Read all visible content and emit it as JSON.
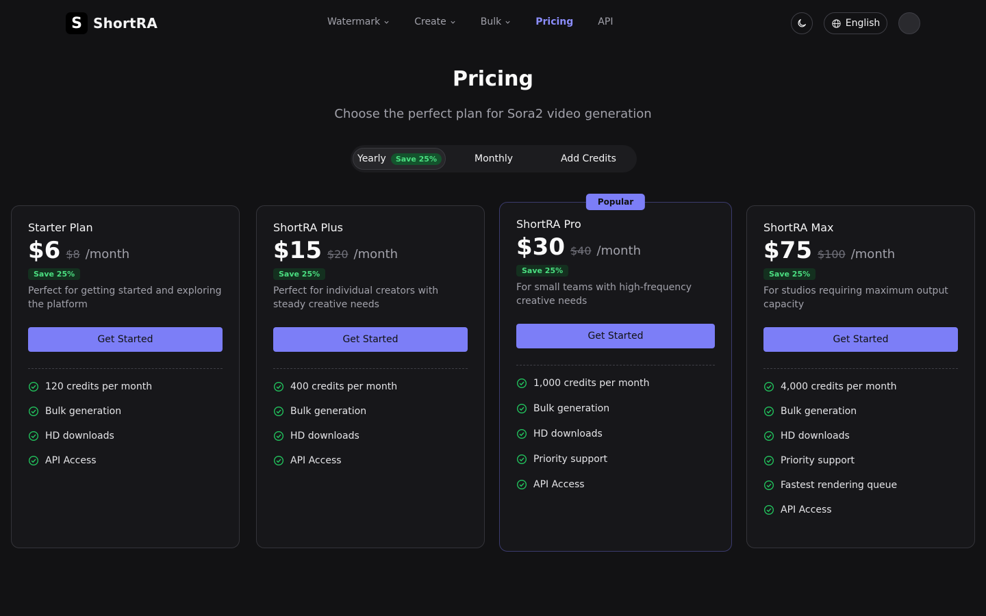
{
  "brand": {
    "logo_letter": "S",
    "name": "ShortRA"
  },
  "nav": {
    "items": [
      {
        "label": "Watermark",
        "dropdown": true
      },
      {
        "label": "Create",
        "dropdown": true
      },
      {
        "label": "Bulk",
        "dropdown": true
      },
      {
        "label": "Pricing",
        "active": true
      },
      {
        "label": "API"
      }
    ]
  },
  "header": {
    "theme_icon": "moon-icon",
    "language": "English"
  },
  "hero": {
    "title": "Pricing",
    "subtitle": "Choose the perfect plan for Sora2 video generation"
  },
  "billing_toggle": {
    "yearly": "Yearly",
    "yearly_badge": "Save 25%",
    "monthly": "Monthly",
    "credits": "Add Credits",
    "selected": "Yearly"
  },
  "colors": {
    "accent": "#7c7ef7",
    "save_green": "#4ade80",
    "background": "#121214"
  },
  "plans": [
    {
      "name": "Starter Plan",
      "price": "$6",
      "old_price": "$8",
      "period": "/month",
      "save": "Save 25%",
      "description": "Perfect for getting started and exploring the platform",
      "cta": "Get Started",
      "features": [
        "120 credits per month",
        "Bulk generation",
        "HD downloads",
        "API Access"
      ]
    },
    {
      "name": "ShortRA Plus",
      "price": "$15",
      "old_price": "$20",
      "period": "/month",
      "save": "Save 25%",
      "description": "Perfect for individual creators with steady creative needs",
      "cta": "Get Started",
      "features": [
        "400 credits per month",
        "Bulk generation",
        "HD downloads",
        "API Access"
      ]
    },
    {
      "name": "ShortRA Pro",
      "price": "$30",
      "old_price": "$40",
      "period": "/month",
      "save": "Save 25%",
      "badge": "Popular",
      "description": "For small teams with high-frequency creative needs",
      "cta": "Get Started",
      "features": [
        "1,000 credits per month",
        "Bulk generation",
        "HD downloads",
        "Priority support",
        "API Access"
      ]
    },
    {
      "name": "ShortRA Max",
      "price": "$75",
      "old_price": "$100",
      "period": "/month",
      "save": "Save 25%",
      "description": "For studios requiring maximum output capacity",
      "cta": "Get Started",
      "features": [
        "4,000 credits per month",
        "Bulk generation",
        "HD downloads",
        "Priority support",
        "Fastest rendering queue",
        "API Access"
      ]
    }
  ]
}
